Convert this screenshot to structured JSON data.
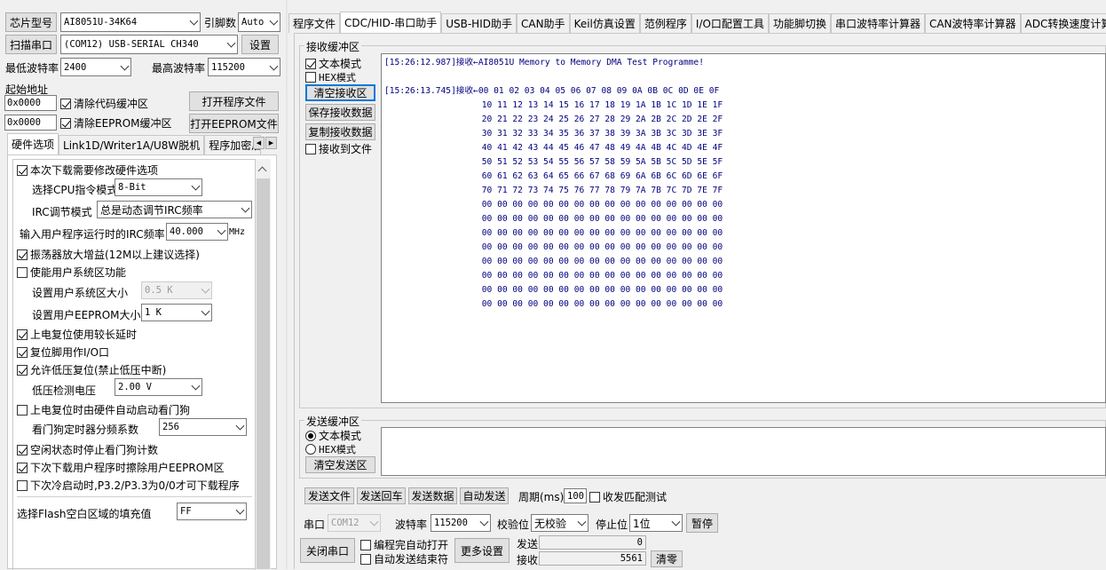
{
  "top": {
    "chip_label": "芯片型号",
    "chip_value": "AI8051U-34K64",
    "pin_label": "引脚数",
    "pin_value": "Auto",
    "scan_button": "扫描串口",
    "port_value": "(COM12) USB-SERIAL CH340",
    "settings_button": "设置",
    "min_baud_label": "最低波特率",
    "min_baud_value": "2400",
    "max_baud_label": "最高波特率",
    "max_baud_value": "115200",
    "start_addr_label": "起始地址",
    "addr1_value": "0x0000",
    "clear_code_label": "清除代码缓冲区",
    "open_prog_button": "打开程序文件",
    "addr2_value": "0x0000",
    "clear_eeprom_label": "清除EEPROM缓冲区",
    "open_eeprom_button": "打开EEPROM文件"
  },
  "left_tabs": [
    "硬件选项",
    "Link1D/Writer1A/U8W脱机",
    "程序加密后"
  ],
  "hw": {
    "modify_hw": "本次下载需要修改硬件选项",
    "cpu_mode_label": "选择CPU指令模式",
    "cpu_mode_value": "8-Bit",
    "irc_mode_label": "IRC调节模式",
    "irc_mode_value": "总是动态调节IRC频率",
    "irc_freq_label": "输入用户程序运行时的IRC频率",
    "irc_freq_value": "40.000",
    "irc_freq_unit": "MHz",
    "osc_gain": "振荡器放大增益(12M以上建议选择)",
    "user_sys_enable": "使能用户系统区功能",
    "user_sys_size_label": "设置用户系统区大小",
    "user_sys_size_value": "0.5 K",
    "eeprom_size_label": "设置用户EEPROM大小",
    "eeprom_size_value": "1  K",
    "power_reset": "上电复位使用较长延时",
    "reset_pin": "复位脚用作I/O口",
    "low_volt_reset": "允许低压复位(禁止低压中断)",
    "low_volt_label": "低压检测电压",
    "low_volt_value": "2.00 V",
    "wdt_auto": "上电复位时由硬件自动启动看门狗",
    "wdt_div_label": "看门狗定时器分频系数",
    "wdt_div_value": "256",
    "idle_wdt": "空闲状态时停止看门狗计数",
    "erase_eeprom": "下次下载用户程序时擦除用户EEPROM区",
    "cold_boot": "下次冷启动时,P3.2/P3.3为0/0才可下载程序",
    "flash_fill_label": "选择Flash空白区域的填充值",
    "flash_fill_value": "FF"
  },
  "right_tabs": [
    "程序文件",
    "CDC/HID-串口助手",
    "USB-HID助手",
    "CAN助手",
    "Keil仿真设置",
    "范例程序",
    "I/O口配置工具",
    "功能脚切换",
    "串口波特率计算器",
    "CAN波特率计算器",
    "ADC转换速度计算器"
  ],
  "recv": {
    "group_title": "接收缓冲区",
    "text_mode": "文本模式",
    "hex_mode": "HEX模式",
    "clear_button": "清空接收区",
    "save_button": "保存接收数据",
    "copy_button": "复制接收数据",
    "to_file": "接收到文件",
    "lines": [
      "[15:26:12.987]接收←AI8051U Memory to Memory DMA Test Programme!",
      "",
      "[15:26:13.745]接收←00 01 02 03 04 05 06 07 08 09 0A 0B 0C 0D 0E 0F",
      "                   10 11 12 13 14 15 16 17 18 19 1A 1B 1C 1D 1E 1F",
      "                   20 21 22 23 24 25 26 27 28 29 2A 2B 2C 2D 2E 2F",
      "                   30 31 32 33 34 35 36 37 38 39 3A 3B 3C 3D 3E 3F",
      "                   40 41 42 43 44 45 46 47 48 49 4A 4B 4C 4D 4E 4F",
      "                   50 51 52 53 54 55 56 57 58 59 5A 5B 5C 5D 5E 5F",
      "                   60 61 62 63 64 65 66 67 68 69 6A 6B 6C 6D 6E 6F",
      "                   70 71 72 73 74 75 76 77 78 79 7A 7B 7C 7D 7E 7F",
      "                   00 00 00 00 00 00 00 00 00 00 00 00 00 00 00 00",
      "                   00 00 00 00 00 00 00 00 00 00 00 00 00 00 00 00",
      "                   00 00 00 00 00 00 00 00 00 00 00 00 00 00 00 00",
      "                   00 00 00 00 00 00 00 00 00 00 00 00 00 00 00 00",
      "                   00 00 00 00 00 00 00 00 00 00 00 00 00 00 00 00",
      "                   00 00 00 00 00 00 00 00 00 00 00 00 00 00 00 00",
      "                   00 00 00 00 00 00 00 00 00 00 00 00 00 00 00 00",
      "                   00 00 00 00 00 00 00 00 00 00 00 00 00 00 00 00"
    ]
  },
  "send": {
    "group_title": "发送缓冲区",
    "text_mode": "文本模式",
    "hex_mode": "HEX模式",
    "clear_button": "清空发送区",
    "send_file": "发送文件",
    "send_enter": "发送回车",
    "send_data": "发送数据",
    "auto_send": "自动发送",
    "period_label": "周期(ms)",
    "period_value": "100",
    "match_test": "收发匹配测试"
  },
  "bottom": {
    "port_label": "串口",
    "port_value": "COM12",
    "baud_label": "波特率",
    "baud_value": "115200",
    "parity_label": "校验位",
    "parity_value": "无校验",
    "stop_label": "停止位",
    "stop_value": "1位",
    "pause_button": "暂停",
    "close_button": "关闭串口",
    "auto_open": "编程完自动打开",
    "auto_send_end": "自动发送结束符",
    "more_button": "更多设置",
    "tx_label": "发送",
    "tx_value": "0",
    "rx_label": "接收",
    "rx_value": "5561",
    "clear_count_button": "清零"
  }
}
